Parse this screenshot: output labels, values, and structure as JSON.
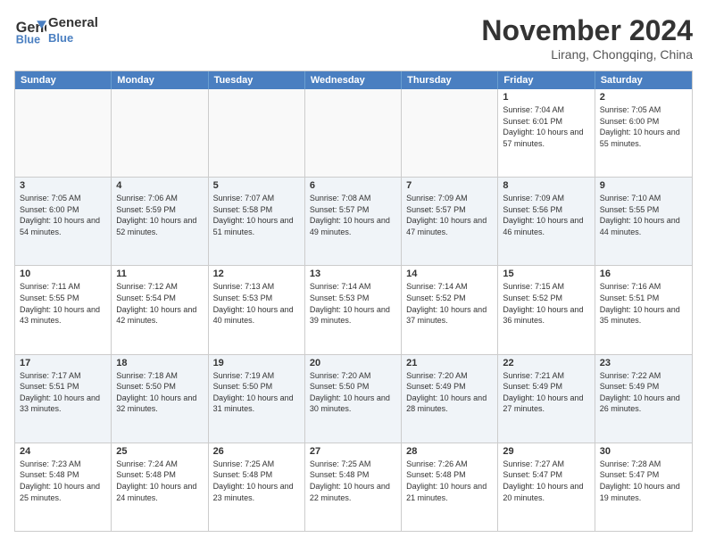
{
  "header": {
    "logo_line1": "General",
    "logo_line2": "Blue",
    "month_title": "November 2024",
    "location": "Lirang, Chongqing, China"
  },
  "days_of_week": [
    "Sunday",
    "Monday",
    "Tuesday",
    "Wednesday",
    "Thursday",
    "Friday",
    "Saturday"
  ],
  "weeks": [
    [
      {
        "day": "",
        "empty": true
      },
      {
        "day": "",
        "empty": true
      },
      {
        "day": "",
        "empty": true
      },
      {
        "day": "",
        "empty": true
      },
      {
        "day": "",
        "empty": true
      },
      {
        "day": "1",
        "sunrise": "7:04 AM",
        "sunset": "6:01 PM",
        "daylight": "10 hours and 57 minutes."
      },
      {
        "day": "2",
        "sunrise": "7:05 AM",
        "sunset": "6:00 PM",
        "daylight": "10 hours and 55 minutes."
      }
    ],
    [
      {
        "day": "3",
        "sunrise": "7:05 AM",
        "sunset": "6:00 PM",
        "daylight": "10 hours and 54 minutes."
      },
      {
        "day": "4",
        "sunrise": "7:06 AM",
        "sunset": "5:59 PM",
        "daylight": "10 hours and 52 minutes."
      },
      {
        "day": "5",
        "sunrise": "7:07 AM",
        "sunset": "5:58 PM",
        "daylight": "10 hours and 51 minutes."
      },
      {
        "day": "6",
        "sunrise": "7:08 AM",
        "sunset": "5:57 PM",
        "daylight": "10 hours and 49 minutes."
      },
      {
        "day": "7",
        "sunrise": "7:09 AM",
        "sunset": "5:57 PM",
        "daylight": "10 hours and 47 minutes."
      },
      {
        "day": "8",
        "sunrise": "7:09 AM",
        "sunset": "5:56 PM",
        "daylight": "10 hours and 46 minutes."
      },
      {
        "day": "9",
        "sunrise": "7:10 AM",
        "sunset": "5:55 PM",
        "daylight": "10 hours and 44 minutes."
      }
    ],
    [
      {
        "day": "10",
        "sunrise": "7:11 AM",
        "sunset": "5:55 PM",
        "daylight": "10 hours and 43 minutes."
      },
      {
        "day": "11",
        "sunrise": "7:12 AM",
        "sunset": "5:54 PM",
        "daylight": "10 hours and 42 minutes."
      },
      {
        "day": "12",
        "sunrise": "7:13 AM",
        "sunset": "5:53 PM",
        "daylight": "10 hours and 40 minutes."
      },
      {
        "day": "13",
        "sunrise": "7:14 AM",
        "sunset": "5:53 PM",
        "daylight": "10 hours and 39 minutes."
      },
      {
        "day": "14",
        "sunrise": "7:14 AM",
        "sunset": "5:52 PM",
        "daylight": "10 hours and 37 minutes."
      },
      {
        "day": "15",
        "sunrise": "7:15 AM",
        "sunset": "5:52 PM",
        "daylight": "10 hours and 36 minutes."
      },
      {
        "day": "16",
        "sunrise": "7:16 AM",
        "sunset": "5:51 PM",
        "daylight": "10 hours and 35 minutes."
      }
    ],
    [
      {
        "day": "17",
        "sunrise": "7:17 AM",
        "sunset": "5:51 PM",
        "daylight": "10 hours and 33 minutes."
      },
      {
        "day": "18",
        "sunrise": "7:18 AM",
        "sunset": "5:50 PM",
        "daylight": "10 hours and 32 minutes."
      },
      {
        "day": "19",
        "sunrise": "7:19 AM",
        "sunset": "5:50 PM",
        "daylight": "10 hours and 31 minutes."
      },
      {
        "day": "20",
        "sunrise": "7:20 AM",
        "sunset": "5:50 PM",
        "daylight": "10 hours and 30 minutes."
      },
      {
        "day": "21",
        "sunrise": "7:20 AM",
        "sunset": "5:49 PM",
        "daylight": "10 hours and 28 minutes."
      },
      {
        "day": "22",
        "sunrise": "7:21 AM",
        "sunset": "5:49 PM",
        "daylight": "10 hours and 27 minutes."
      },
      {
        "day": "23",
        "sunrise": "7:22 AM",
        "sunset": "5:49 PM",
        "daylight": "10 hours and 26 minutes."
      }
    ],
    [
      {
        "day": "24",
        "sunrise": "7:23 AM",
        "sunset": "5:48 PM",
        "daylight": "10 hours and 25 minutes."
      },
      {
        "day": "25",
        "sunrise": "7:24 AM",
        "sunset": "5:48 PM",
        "daylight": "10 hours and 24 minutes."
      },
      {
        "day": "26",
        "sunrise": "7:25 AM",
        "sunset": "5:48 PM",
        "daylight": "10 hours and 23 minutes."
      },
      {
        "day": "27",
        "sunrise": "7:25 AM",
        "sunset": "5:48 PM",
        "daylight": "10 hours and 22 minutes."
      },
      {
        "day": "28",
        "sunrise": "7:26 AM",
        "sunset": "5:48 PM",
        "daylight": "10 hours and 21 minutes."
      },
      {
        "day": "29",
        "sunrise": "7:27 AM",
        "sunset": "5:47 PM",
        "daylight": "10 hours and 20 minutes."
      },
      {
        "day": "30",
        "sunrise": "7:28 AM",
        "sunset": "5:47 PM",
        "daylight": "10 hours and 19 minutes."
      }
    ]
  ]
}
